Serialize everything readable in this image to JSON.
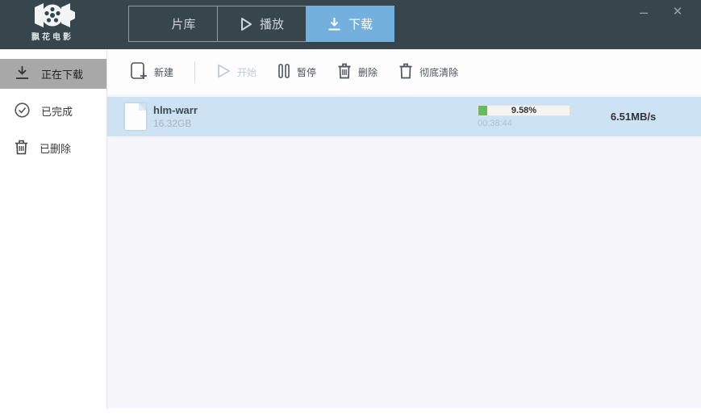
{
  "app": {
    "logo_text": "飘花电影"
  },
  "window_controls": {
    "minimize": "–",
    "close": "✕"
  },
  "tabs": [
    {
      "label": "片库",
      "icon": "library-menu-icon",
      "active": false
    },
    {
      "label": "播放",
      "icon": "play-icon",
      "active": false
    },
    {
      "label": "下载",
      "icon": "download-icon",
      "active": true
    }
  ],
  "sidebar": {
    "items": [
      {
        "label": "正在下载",
        "icon": "downloading-icon",
        "active": true
      },
      {
        "label": "已完成",
        "icon": "check-circle-icon",
        "active": false
      },
      {
        "label": "已删除",
        "icon": "trash-icon",
        "active": false
      }
    ]
  },
  "toolbar": {
    "buttons": [
      {
        "label": "新建",
        "icon": "new-task-icon",
        "disabled": false
      },
      {
        "label": "开始",
        "icon": "start-icon",
        "disabled": true
      },
      {
        "label": "暂停",
        "icon": "pause-icon",
        "disabled": false
      },
      {
        "label": "删除",
        "icon": "delete-icon",
        "disabled": false
      },
      {
        "label": "彻底清除",
        "icon": "purge-icon",
        "disabled": false
      }
    ]
  },
  "downloads": [
    {
      "name": "hlm-warr",
      "size": "16.32GB",
      "progress_label": "9.58%",
      "progress_value": 9.58,
      "time_elapsed": "00:38:44",
      "speed": "6.51MB/s"
    }
  ],
  "colors": {
    "topbar_bg": "#37464d",
    "active_tab_bg": "#74b0de",
    "row_bg": "#cde2f2",
    "progress_fill": "#66bb5c",
    "sidebar_active_bg": "#a8a8a8",
    "main_bg": "#f5f5fa"
  }
}
